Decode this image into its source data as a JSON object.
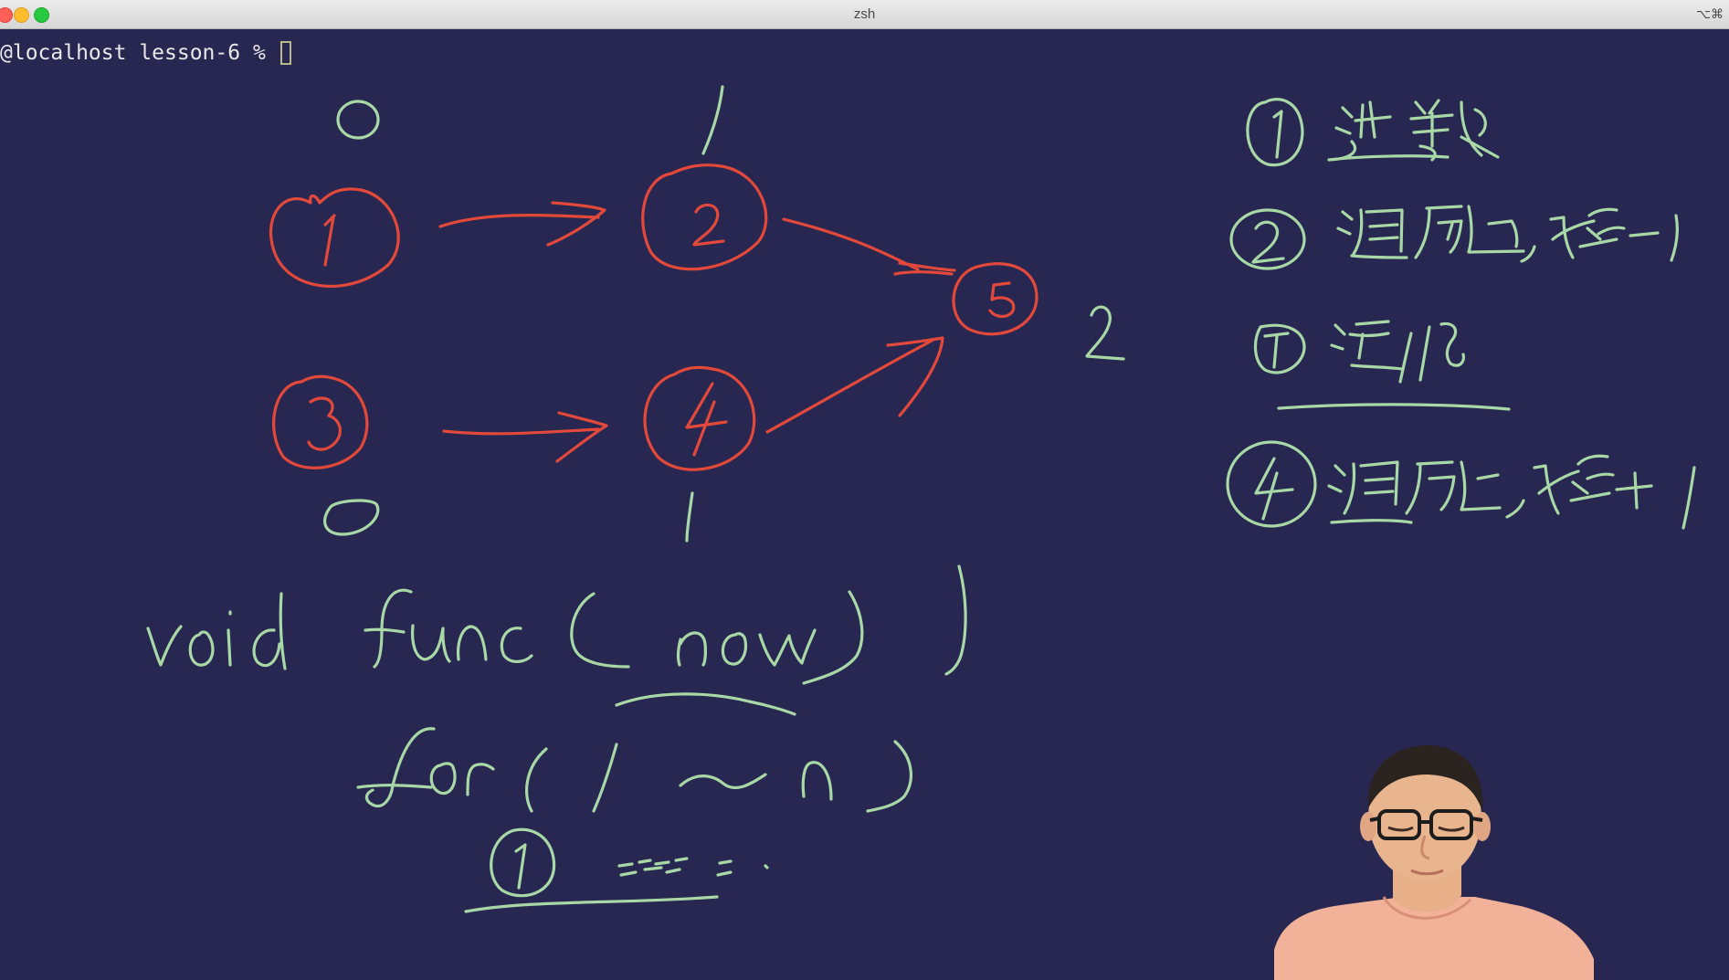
{
  "window": {
    "title": "zsh",
    "shortcut": "⌥⌘"
  },
  "terminal": {
    "prompt": "@localhost lesson-6 % "
  },
  "colors": {
    "background": "#272751",
    "red_ink": "#e3493a",
    "green_ink": "#a8d8a6"
  }
}
